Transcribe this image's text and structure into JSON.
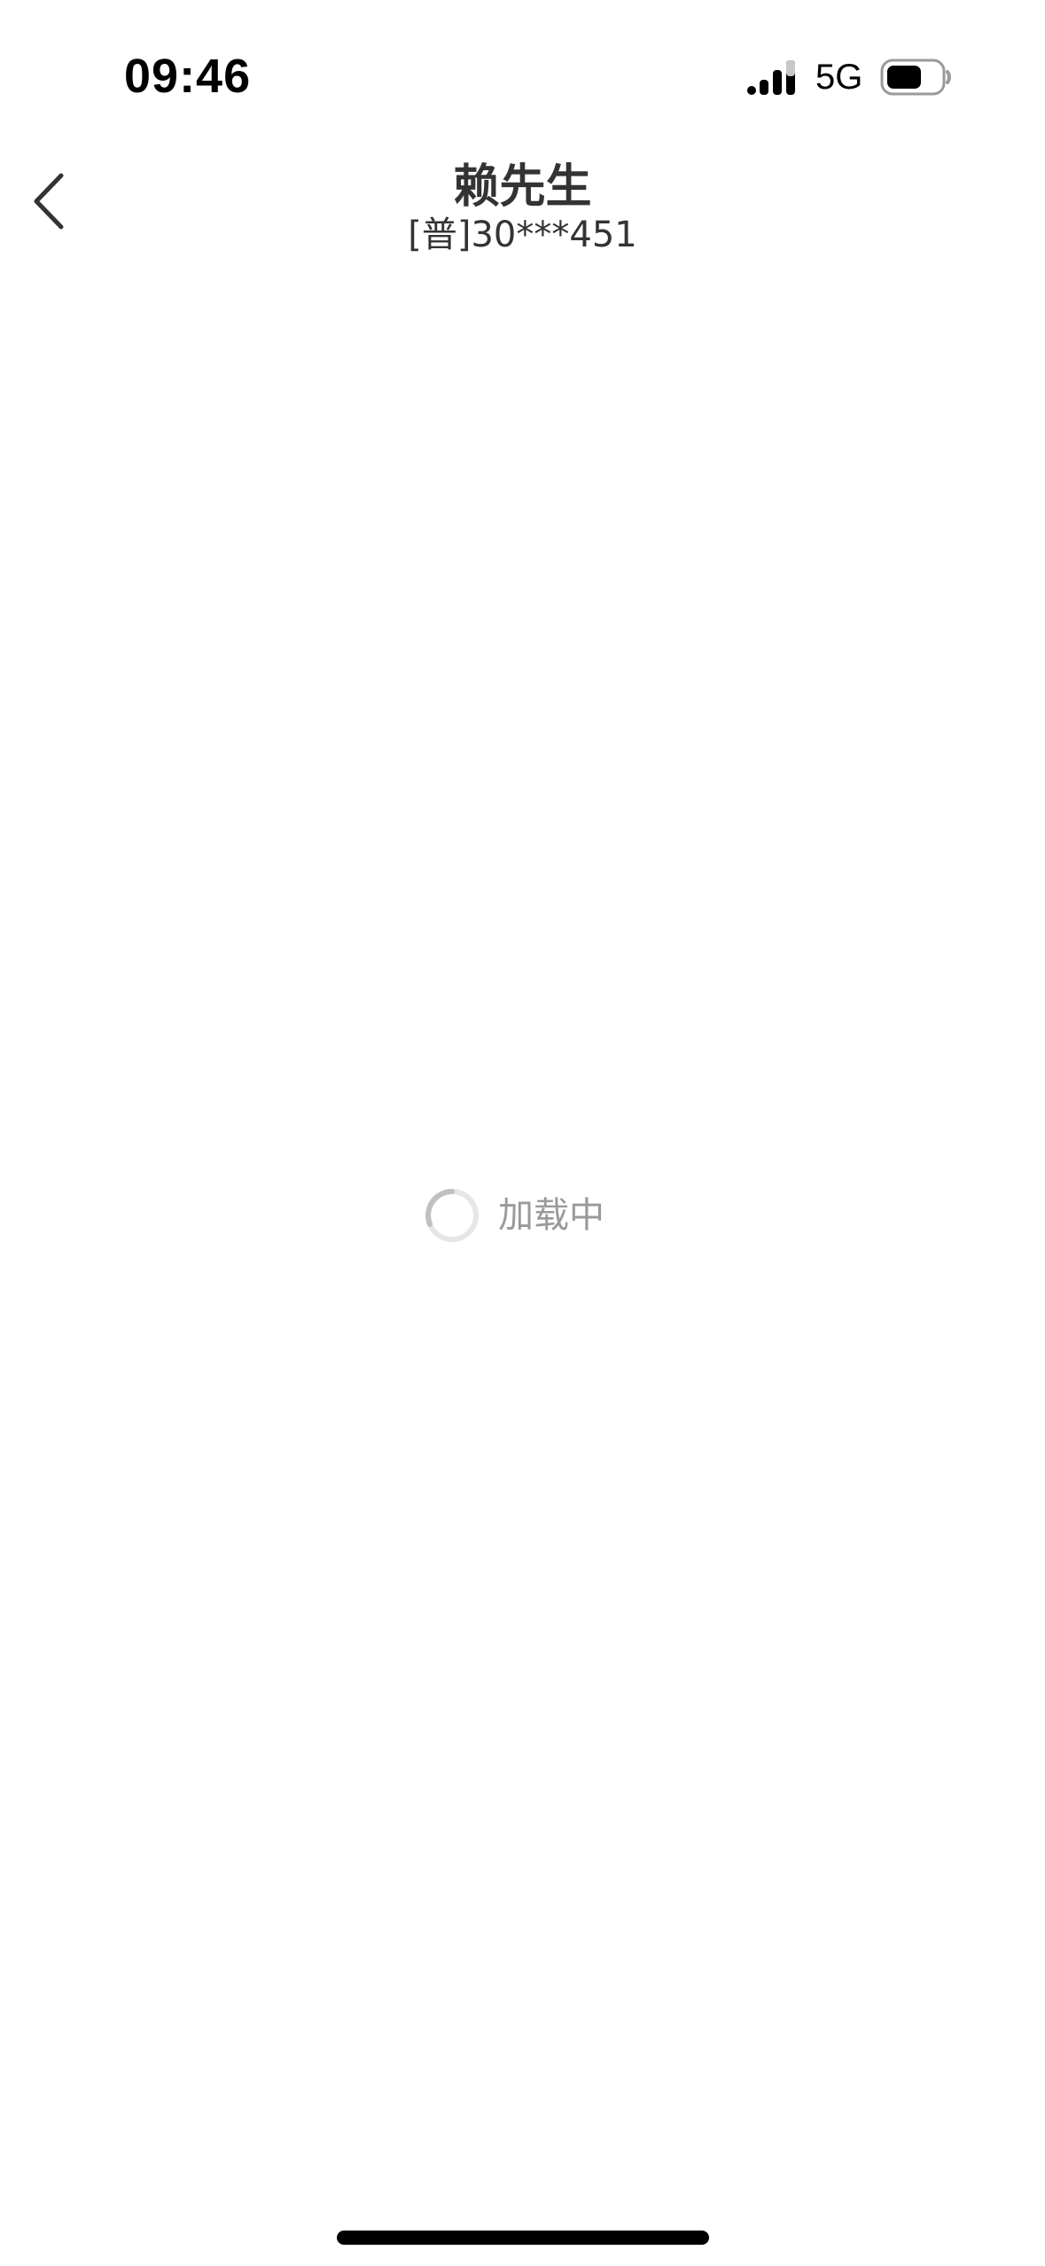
{
  "status_bar": {
    "time": "09:46",
    "network": "5G"
  },
  "nav": {
    "title": "赖先生",
    "subtitle": "[普]30***451",
    "back_icon": "chevron-left-icon"
  },
  "loading": {
    "text": "加载中",
    "icon": "spinner-icon"
  },
  "colors": {
    "background": "#ffffff",
    "title": "#333333",
    "loading_text": "#9a9a9a",
    "spinner_track": "#e6e6e6",
    "spinner_arc": "#c0c0c0"
  }
}
